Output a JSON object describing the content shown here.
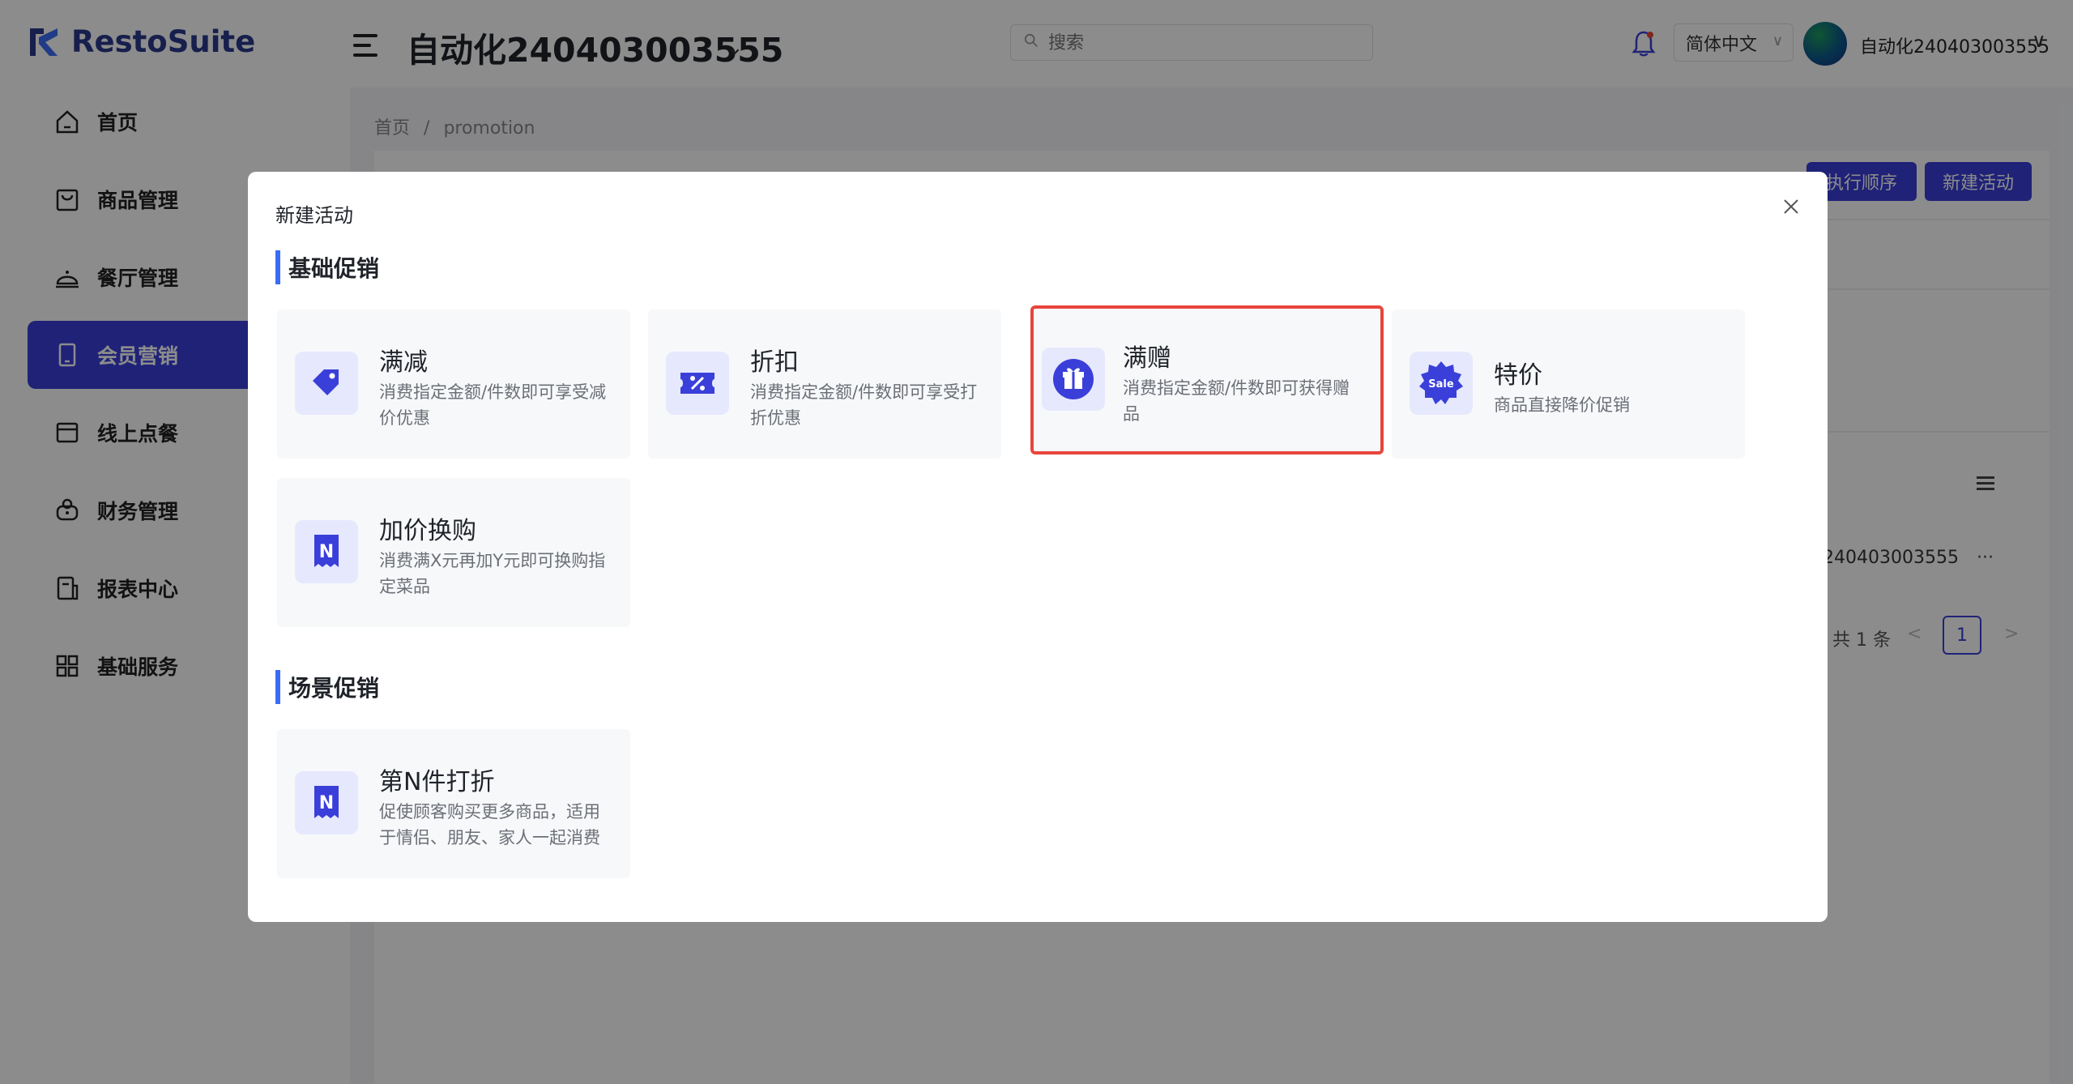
{
  "brand": {
    "name": "RestoSuite"
  },
  "header": {
    "store_name": "自动化240403003555",
    "search_placeholder": "搜索",
    "language": "简体中文",
    "username": "自动化240403003555"
  },
  "sidebar": {
    "items": [
      {
        "label": "首页",
        "icon": "home-icon"
      },
      {
        "label": "商品管理",
        "icon": "bag-icon"
      },
      {
        "label": "餐厅管理",
        "icon": "cloche-icon"
      },
      {
        "label": "会员营销",
        "icon": "phone-icon"
      },
      {
        "label": "线上点餐",
        "icon": "register-icon"
      },
      {
        "label": "财务管理",
        "icon": "wallet-icon"
      },
      {
        "label": "报表中心",
        "icon": "report-icon"
      },
      {
        "label": "基础服务",
        "icon": "grid-icon"
      }
    ],
    "active_index": 3
  },
  "breadcrumb": {
    "home": "首页",
    "separator": "/",
    "current": "promotion"
  },
  "background": {
    "btn_execution_order": "执行顺序",
    "btn_new_activity": "新建活动",
    "table_cell": "240403003555",
    "table_ellipsis": "···",
    "total": "共 1 条",
    "prev": "<",
    "page": "1",
    "next": ">"
  },
  "modal": {
    "title": "新建活动",
    "sections": [
      {
        "title": "基础促销",
        "cards": [
          {
            "title": "满减",
            "desc": "消费指定金额/件数即可享受减价优惠",
            "icon": "price-tag-icon"
          },
          {
            "title": "折扣",
            "desc": "消费指定金额/件数即可享受打折优惠",
            "icon": "discount-coupon-icon"
          },
          {
            "title": "满赠",
            "desc": "消费指定金额/件数即可获得赠品",
            "icon": "gift-icon",
            "selected": true
          },
          {
            "title": "特价",
            "desc": "商品直接降价促销",
            "icon": "sale-badge-icon",
            "badge_text": "Sale"
          },
          {
            "title": "加价换购",
            "desc": "消费满X元再加Y元即可换购指定菜品",
            "icon": "n-voucher-icon",
            "badge_text": "N"
          }
        ]
      },
      {
        "title": "场景促销",
        "cards": [
          {
            "title": "第N件打折",
            "desc": "促使顾客购买更多商品，适用于情侣、朋友、家人一起消费",
            "icon": "n-voucher-icon",
            "badge_text": "N"
          }
        ]
      }
    ]
  },
  "colors": {
    "primary": "#3a3fd9",
    "accent_bar": "#3b6cf6",
    "selected_border": "#e8453c",
    "icon_bg": "#e6e8fd",
    "brand_text": "#2a3a8c"
  }
}
